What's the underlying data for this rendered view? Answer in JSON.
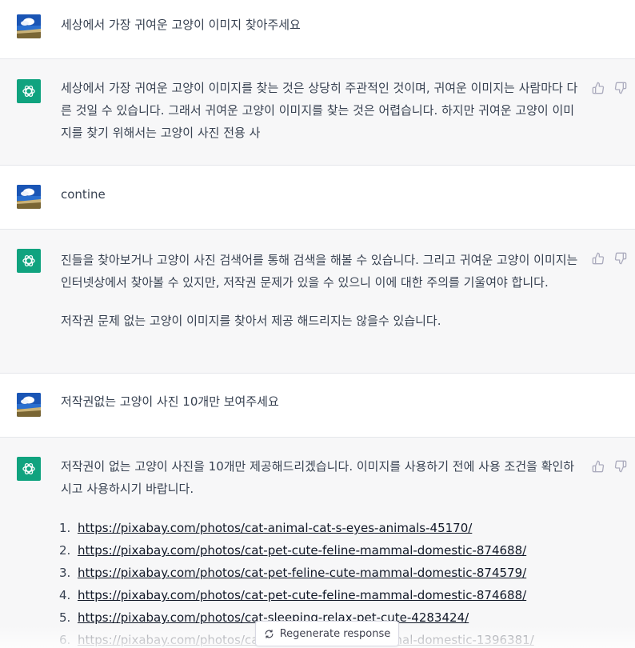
{
  "conversation": [
    {
      "role": "user",
      "text": "세상에서 가장 귀여운 고양이 이미지 찾아주세요"
    },
    {
      "role": "assistant",
      "paragraphs": [
        "세상에서 가장 귀여운 고양이 이미지를 찾는 것은 상당히 주관적인 것이며, 귀여운 이미지는 사람마다 다른 것일 수 있습니다. 그래서 귀여운 고양이 이미지를 찾는 것은 어렵습니다. 하지만 귀여운 고양이 이미지를 찾기 위해서는 고양이 사진 전용 사"
      ]
    },
    {
      "role": "user",
      "text": "contine"
    },
    {
      "role": "assistant",
      "paragraphs": [
        "진들을 찾아보거나 고양이 사진 검색어를 통해 검색을 해볼 수 있습니다. 그리고 귀여운 고양이 이미지는 인터넷상에서 찾아볼 수 있지만, 저작권 문제가 있을 수 있으니 이에 대한 주의를 기울여야 합니다.",
        "저작권 문제 없는 고양이 이미지를 찾아서 제공 해드리지는 않을수 있습니다."
      ]
    },
    {
      "role": "user",
      "text": "저작권없는 고양이 사진 10개만 보여주세요"
    },
    {
      "role": "assistant",
      "paragraphs": [
        "저작권이 없는 고양이 사진을 10개만 제공해드리겠습니다. 이미지를 사용하기 전에 사용 조건을 확인하시고 사용하시기 바랍니다."
      ],
      "links": [
        {
          "num": "1.",
          "url": "https://pixabay.com/photos/cat-animal-cat-s-eyes-animals-45170/"
        },
        {
          "num": "2.",
          "url": "https://pixabay.com/photos/cat-pet-cute-feline-mammal-domestic-874688/"
        },
        {
          "num": "3.",
          "url": "https://pixabay.com/photos/cat-pet-feline-cute-mammal-domestic-874579/"
        },
        {
          "num": "4.",
          "url": "https://pixabay.com/photos/cat-pet-cute-feline-mammal-domestic-874688/"
        },
        {
          "num": "5.",
          "url": "https://pixabay.com/photos/cat-sleeping-relax-pet-cute-4283424/"
        },
        {
          "num": "6.",
          "url": "https://pixabay.com/photos/cat-pet-cute-feline-mammal-domestic-1396381/"
        }
      ]
    }
  ],
  "regenerate_button": {
    "label": "Regenerate response",
    "icon": "refresh-icon"
  },
  "icons": {
    "thumbs_up": "thumbs-up-icon",
    "thumbs_down": "thumbs-down-icon",
    "assistant_logo": "openai-logo-icon",
    "user_avatar": "user-avatar"
  },
  "colors": {
    "assistant_bg": "#f7f7f8",
    "user_bg": "#ffffff",
    "brand_green": "#10a37f",
    "text": "#374151"
  }
}
